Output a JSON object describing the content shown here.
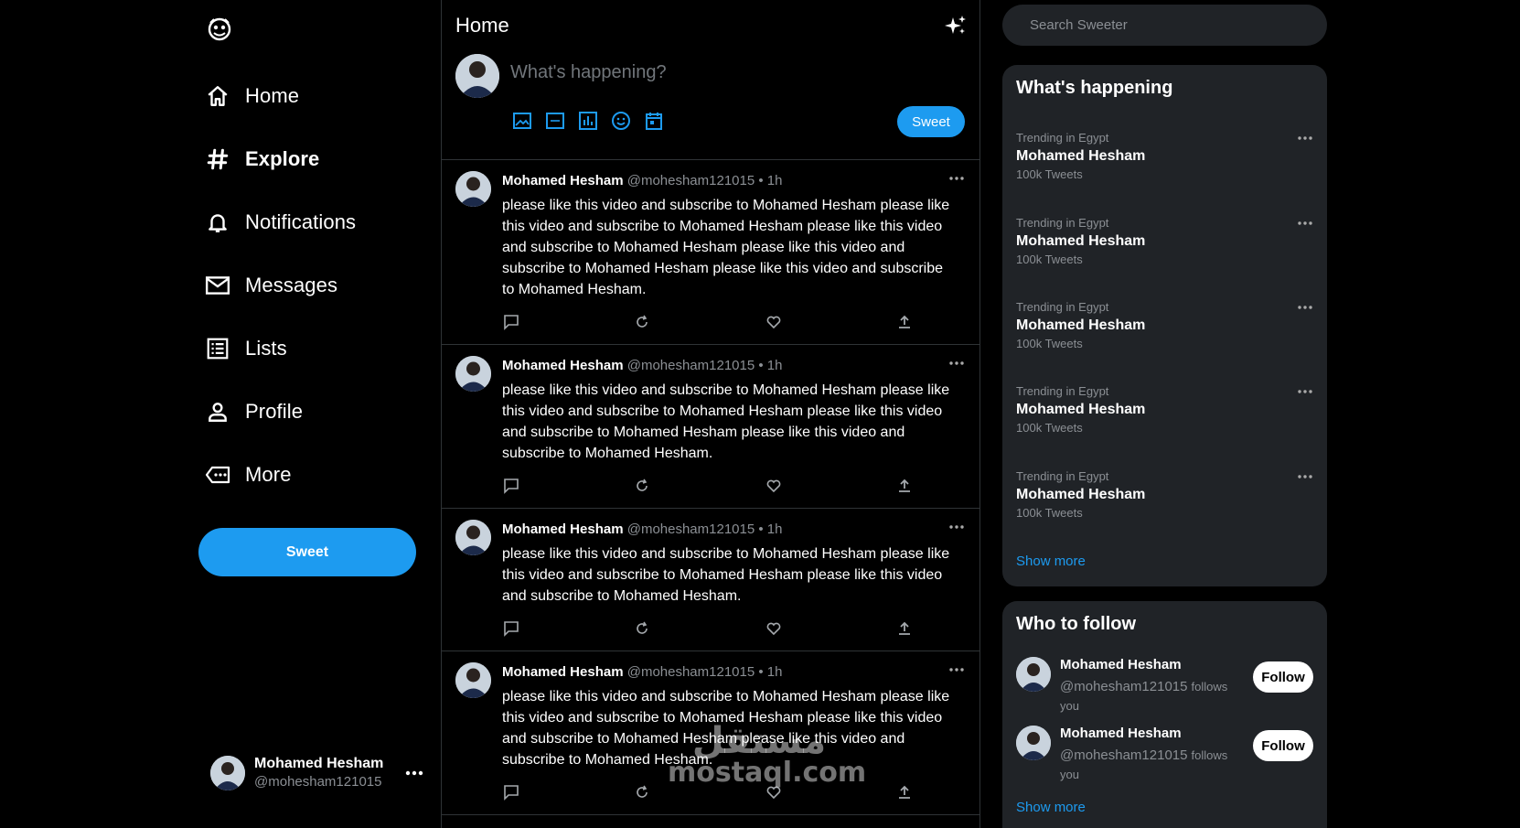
{
  "sidebar": {
    "logo_icon": "twitter-bird-icon",
    "nav": [
      {
        "label": "Home",
        "icon": "home-icon",
        "bold": false
      },
      {
        "label": "Explore",
        "icon": "hashtag-icon",
        "bold": true
      },
      {
        "label": "Notifications",
        "icon": "bell-icon",
        "bold": false
      },
      {
        "label": "Messages",
        "icon": "mail-icon",
        "bold": false
      },
      {
        "label": "Lists",
        "icon": "list-icon",
        "bold": false
      },
      {
        "label": "Profile",
        "icon": "person-icon",
        "bold": false
      },
      {
        "label": "More",
        "icon": "more-tag-icon",
        "bold": false
      }
    ],
    "sweet_label": "Sweet",
    "account": {
      "name": "Mohamed Hesham",
      "handle": "@mohesham121015"
    }
  },
  "main": {
    "title": "Home",
    "composer": {
      "placeholder": "What's happening?",
      "sweet_label": "Sweet"
    },
    "tweets": [
      {
        "name": "Mohamed Hesham",
        "handle": "@mohesham121015",
        "time": "• 1h",
        "text": "please like this video and subscribe to Mohamed Hesham please like this video and subscribe to Mohamed Hesham please like this video and subscribe to Mohamed Hesham please like this video and subscribe to Mohamed Hesham please like this video and subscribe to Mohamed Hesham."
      },
      {
        "name": "Mohamed Hesham",
        "handle": "@mohesham121015",
        "time": "• 1h",
        "text": "please like this video and subscribe to Mohamed Hesham please like this video and subscribe to Mohamed Hesham please like this video and subscribe to Mohamed Hesham please like this video and subscribe to Mohamed Hesham."
      },
      {
        "name": "Mohamed Hesham",
        "handle": "@mohesham121015",
        "time": "• 1h",
        "text": "please like this video and subscribe to Mohamed Hesham please like this video and subscribe to Mohamed Hesham please like this video and subscribe to Mohamed Hesham."
      },
      {
        "name": "Mohamed Hesham",
        "handle": "@mohesham121015",
        "time": "• 1h",
        "text": "please like this video and subscribe to Mohamed Hesham please like this video and subscribe to Mohamed Hesham please like this video and subscribe to Mohamed Hesham please like this video and subscribe to Mohamed Hesham."
      }
    ]
  },
  "right": {
    "search_placeholder": "Search Sweeter",
    "happening": {
      "title": "What's happening",
      "trends": [
        {
          "category": "Trending in Egypt",
          "name": "Mohamed Hesham",
          "count": "100k Tweets"
        },
        {
          "category": "Trending in Egypt",
          "name": "Mohamed Hesham",
          "count": "100k Tweets"
        },
        {
          "category": "Trending in Egypt",
          "name": "Mohamed Hesham",
          "count": "100k Tweets"
        },
        {
          "category": "Trending in Egypt",
          "name": "Mohamed Hesham",
          "count": "100k Tweets"
        },
        {
          "category": "Trending in Egypt",
          "name": "Mohamed Hesham",
          "count": "100k Tweets"
        }
      ],
      "show_more": "Show more"
    },
    "who_to_follow": {
      "title": "Who to follow",
      "people": [
        {
          "name": "Mohamed Hesham",
          "handle": "@mohesham121015",
          "follows": "follows",
          "you": "you",
          "button": "Follow"
        },
        {
          "name": "Mohamed Hesham",
          "handle": "@mohesham121015",
          "follows": "follows",
          "you": "you",
          "button": "Follow"
        }
      ],
      "show_more": "Show more"
    }
  },
  "watermark": {
    "arabic": "مستقل",
    "latin": "mostaql.com"
  },
  "colors": {
    "accent": "#1d9bf0",
    "background": "#000000",
    "panel": "#202327",
    "muted": "#8b8f94",
    "border": "#2f3336"
  }
}
